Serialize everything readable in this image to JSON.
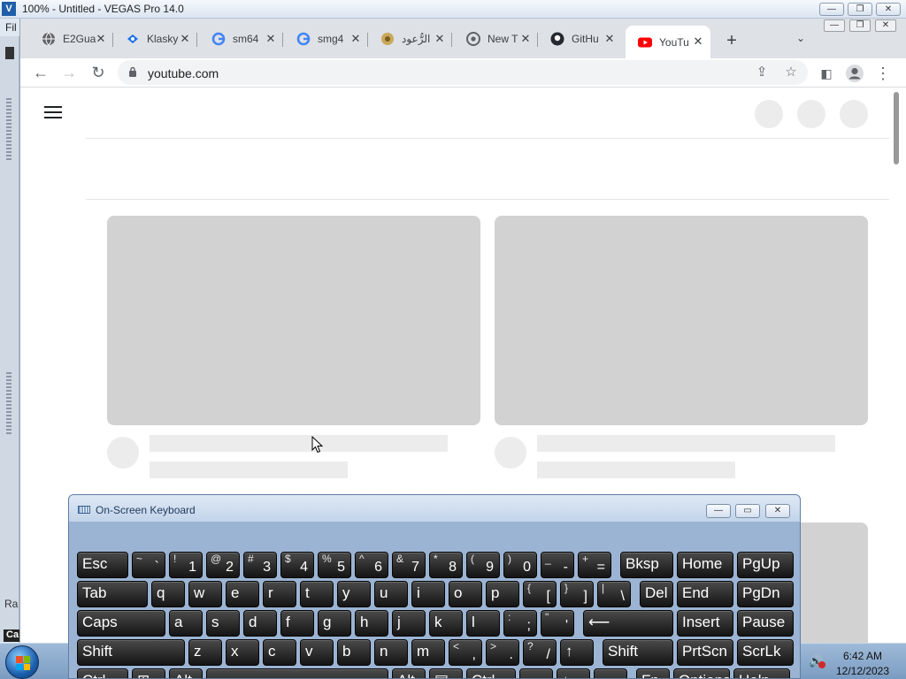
{
  "vegas": {
    "title": "100% - Untitled - VEGAS Pro 14.0",
    "logo": "V",
    "menu_peek": "Fil",
    "side_text_1": "Ra",
    "side_text_2": "Ca",
    "controls": {
      "minimize": "—",
      "restore": "❐",
      "close": "✕"
    }
  },
  "chrome": {
    "tabs": [
      {
        "title": "E2Gua",
        "icon": "globe-icon",
        "color": "#5f6368"
      },
      {
        "title": "Klasky",
        "icon": "klasky-icon",
        "color": "#1a73e8"
      },
      {
        "title": "sm64",
        "icon": "google-icon",
        "color": "#4285f4"
      },
      {
        "title": "smg4",
        "icon": "google-icon",
        "color": "#4285f4"
      },
      {
        "title": "الرُّعود",
        "icon": "quran-icon",
        "color": "#9a7d3a"
      },
      {
        "title": "New T",
        "icon": "chrome-icon",
        "color": "#5f6368"
      },
      {
        "title": "GitHu",
        "icon": "github-icon",
        "color": "#24292f"
      },
      {
        "title": "YouTu",
        "icon": "youtube-icon",
        "color": "#ff0000"
      }
    ],
    "close_glyph": "✕",
    "new_tab": "+",
    "tab_list": "⌄",
    "controls": {
      "minimize": "—",
      "restore": "❐",
      "close": "✕"
    },
    "url": "youtube.com",
    "nav": {
      "back": "←",
      "forward": "→",
      "reload": "↻"
    },
    "icons": {
      "share": "⇪",
      "star": "☆",
      "sidepanel": "◧",
      "menu": "⋮"
    }
  },
  "osk": {
    "title": "On-Screen Keyboard",
    "controls": {
      "minimize": "—",
      "restore": "▭",
      "close": "✕"
    },
    "rows": [
      [
        {
          "main": "Esc",
          "w": 58
        },
        {
          "main": "`",
          "sec": "~",
          "w": 38,
          "dual": true
        },
        {
          "main": "1",
          "sec": "!",
          "w": 38,
          "dual": true
        },
        {
          "main": "2",
          "sec": "@",
          "w": 38,
          "dual": true
        },
        {
          "main": "3",
          "sec": "#",
          "w": 38,
          "dual": true
        },
        {
          "main": "4",
          "sec": "$",
          "w": 38,
          "dual": true
        },
        {
          "main": "5",
          "sec": "%",
          "w": 38,
          "dual": true
        },
        {
          "main": "6",
          "sec": "^",
          "w": 38,
          "dual": true
        },
        {
          "main": "7",
          "sec": "&",
          "w": 38,
          "dual": true
        },
        {
          "main": "8",
          "sec": "*",
          "w": 38,
          "dual": true
        },
        {
          "main": "9",
          "sec": "(",
          "w": 38,
          "dual": true
        },
        {
          "main": "0",
          "sec": ")",
          "w": 38,
          "dual": true
        },
        {
          "main": "-",
          "sec": "_",
          "w": 38,
          "dual": true
        },
        {
          "main": "=",
          "sec": "+",
          "w": 38,
          "dual": true
        },
        {
          "main": "Bksp",
          "w": 60,
          "gap": 6
        },
        {
          "main": "Home",
          "w": 64
        },
        {
          "main": "PgUp",
          "w": 64
        }
      ],
      [
        {
          "main": "Tab",
          "w": 80
        },
        {
          "main": "q",
          "w": 38
        },
        {
          "main": "w",
          "w": 38
        },
        {
          "main": "e",
          "w": 38
        },
        {
          "main": "r",
          "w": 38
        },
        {
          "main": "t",
          "w": 38
        },
        {
          "main": "y",
          "w": 38
        },
        {
          "main": "u",
          "w": 38
        },
        {
          "main": "i",
          "w": 38
        },
        {
          "main": "o",
          "w": 38
        },
        {
          "main": "p",
          "w": 38
        },
        {
          "main": "[",
          "sec": "{",
          "w": 38,
          "dual": true
        },
        {
          "main": "]",
          "sec": "}",
          "w": 38,
          "dual": true
        },
        {
          "main": "\\",
          "sec": "|",
          "w": 38,
          "dual": true
        },
        {
          "main": "Del",
          "w": 38,
          "gap": 6
        },
        {
          "main": "End",
          "w": 64
        },
        {
          "main": "PgDn",
          "w": 64
        }
      ],
      [
        {
          "main": "Caps",
          "w": 100
        },
        {
          "main": "a",
          "w": 38
        },
        {
          "main": "s",
          "w": 38
        },
        {
          "main": "d",
          "w": 38
        },
        {
          "main": "f",
          "w": 38
        },
        {
          "main": "g",
          "w": 38
        },
        {
          "main": "h",
          "w": 38
        },
        {
          "main": "j",
          "w": 38
        },
        {
          "main": "k",
          "w": 38
        },
        {
          "main": "l",
          "w": 38
        },
        {
          "main": ";",
          "sec": ":",
          "w": 38,
          "dual": true
        },
        {
          "main": "'",
          "sec": "\"",
          "w": 38,
          "dual": true
        },
        {
          "main": "⟵",
          "w": 102,
          "gap": 6
        },
        {
          "main": "Insert",
          "w": 64
        },
        {
          "main": "Pause",
          "w": 64
        }
      ],
      [
        {
          "main": "Shift",
          "w": 122
        },
        {
          "main": "z",
          "w": 38
        },
        {
          "main": "x",
          "w": 38
        },
        {
          "main": "c",
          "w": 38
        },
        {
          "main": "v",
          "w": 38
        },
        {
          "main": "b",
          "w": 38
        },
        {
          "main": "n",
          "w": 38
        },
        {
          "main": "m",
          "w": 38
        },
        {
          "main": ",",
          "sec": "<",
          "w": 38,
          "dual": true
        },
        {
          "main": ".",
          "sec": ">",
          "w": 38,
          "dual": true
        },
        {
          "main": "/",
          "sec": "?",
          "w": 38,
          "dual": true
        },
        {
          "main": "↑",
          "w": 38
        },
        {
          "main": "Shift",
          "w": 80,
          "gap": 6
        },
        {
          "main": "PrtScn",
          "w": 64
        },
        {
          "main": "ScrLk",
          "w": 64
        }
      ],
      [
        {
          "main": "Ctrl",
          "w": 58
        },
        {
          "main": "⊞",
          "w": 38
        },
        {
          "main": "Alt",
          "w": 38
        },
        {
          "main": "",
          "w": 206
        },
        {
          "main": "Alt",
          "w": 38
        },
        {
          "main": "▤",
          "w": 38
        },
        {
          "main": "Ctrl",
          "w": 56
        },
        {
          "main": "←",
          "w": 38
        },
        {
          "main": "↓",
          "w": 38
        },
        {
          "main": "→",
          "w": 38
        },
        {
          "main": "Fn",
          "w": 38,
          "gap": 6
        },
        {
          "main": "Options",
          "w": 64
        },
        {
          "main": "Help",
          "w": 64
        }
      ]
    ]
  },
  "taskbar": {
    "time": "6:42 AM",
    "date": "12/12/2023",
    "volume_icon": "🔊"
  }
}
